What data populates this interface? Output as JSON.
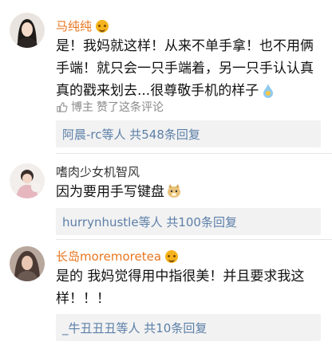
{
  "comments": [
    {
      "author": "马纯纯",
      "text": "是！我妈就这样！从来不单手拿！也不用俩手端！就只会一只手端着，另一只手认认真真的戳来划去...很尊敬手机的样子",
      "liked_by": "博主",
      "liked_text": "赞了这条评论",
      "replies": "阿晨-rc等人  共548条回复"
    },
    {
      "author": "嗜肉少女机智风",
      "text": "因为要用手写键盘",
      "replies": "hurrynhustle等人  共100条回复"
    },
    {
      "author": "长岛moremoretea",
      "text": "是的 我妈觉得用中指很美！并且要求我这样！！！",
      "replies": "_牛丑丑丑等人  共10条回复"
    }
  ],
  "colors": {
    "vip_name": "#e8761f",
    "link": "#5c7fa8",
    "reply_bg": "#f2f2f2"
  }
}
